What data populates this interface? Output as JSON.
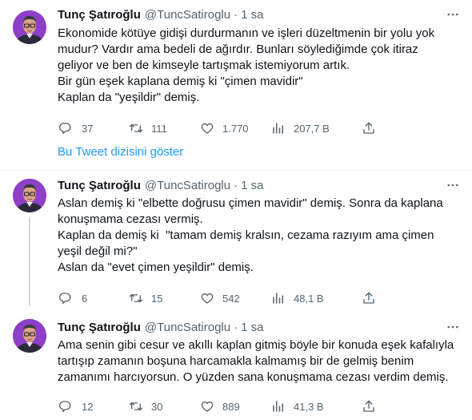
{
  "show_thread_label": "Bu Tweet dizisini göster",
  "tweets": [
    {
      "name": "Tunç Şatıroğlu",
      "handle": "@TuncSatiroglu",
      "dot": "·",
      "time": "1 sa",
      "text": "Ekonomide kötüye gidişi durdurmanın ve işleri düzeltmenin bir yolu yok\nmudur? Vardır ama bedeli de ağırdır. Bunları söylediğimde çok itiraz\ngeliyor ve ben de kimseyle tartışmak istemiyorum artık.\nBir gün eşek kaplana demiş ki \"çimen mavidir\"\nKaplan da \"yeşildir\" demiş.",
      "replies": "37",
      "retweets": "111",
      "likes": "1.770",
      "views": "207,7 B"
    },
    {
      "name": "Tunç Şatıroğlu",
      "handle": "@TuncSatiroglu",
      "dot": "·",
      "time": "1 sa",
      "text": "Aslan demiş ki \"elbette doğrusu çimen mavidir\" demiş. Sonra da kaplana\nkonuşmama cezası vermiş.\nKaplan da demiş ki  \"tamam demiş kralsın, cezama razıyım ama çimen\nyeşil değil mi?\"\nAslan da \"evet çimen yeşildir\" demiş.",
      "replies": "6",
      "retweets": "15",
      "likes": "542",
      "views": "48,1 B"
    },
    {
      "name": "Tunç Şatıroğlu",
      "handle": "@TuncSatiroglu",
      "dot": "·",
      "time": "1 sa",
      "text": "Ama senin gibi cesur ve akıllı kaplan gitmiş böyle bir konuda eşek kafalıyla\ntartışıp zamanın boşuna harcamakla kalmamış bir de gelmiş benim\nzamanımı harcıyorsun. O yüzden sana konuşmama cezası verdim demiş.",
      "replies": "12",
      "retweets": "30",
      "likes": "889",
      "views": "41,3 B"
    }
  ],
  "colors": {
    "text": "#0f1419",
    "secondary": "#536471",
    "link": "#1d9bf0",
    "avatar_bg": "#8d3fc7"
  },
  "icons": [
    "avatar",
    "more-icon",
    "reply-icon",
    "retweet-icon",
    "like-icon",
    "views-icon",
    "share-icon"
  ]
}
